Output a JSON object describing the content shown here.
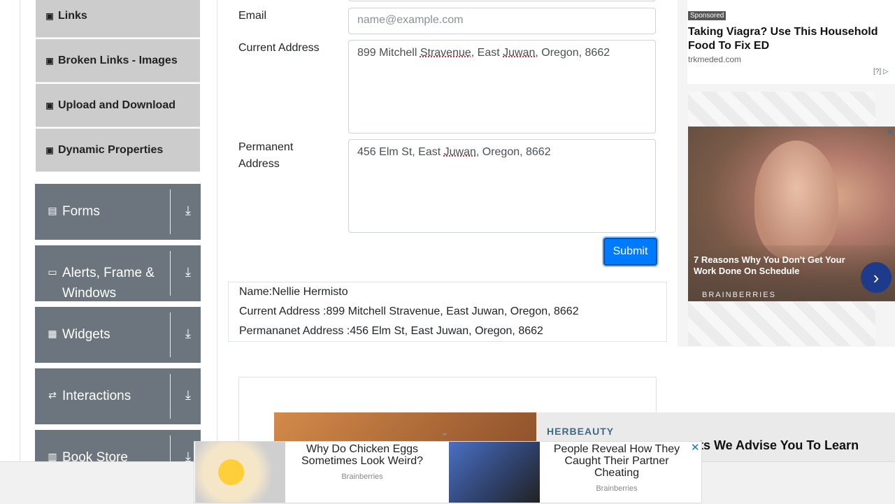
{
  "sidebar": {
    "sub_items": [
      {
        "label": "Links",
        "icon": "html5-icon"
      },
      {
        "label": "Broken Links - Images",
        "icon": "html5-icon"
      },
      {
        "label": "Upload and Download",
        "icon": "html5-icon"
      },
      {
        "label": "Dynamic Properties",
        "icon": "html5-icon"
      }
    ],
    "groups": [
      {
        "label": "Forms",
        "icon": "document-icon"
      },
      {
        "label": "Alerts, Frame & Windows",
        "icon": "window-icon"
      },
      {
        "label": "Widgets",
        "icon": "widgets-icon"
      },
      {
        "label": "Interactions",
        "icon": "arrows-icon"
      },
      {
        "label": "Book Store",
        "icon": "books-icon"
      }
    ]
  },
  "form": {
    "email_label": "Email",
    "email_placeholder": "name@example.com",
    "current_address_label": "Current Address",
    "current_address_parts": [
      "899 Mitchell ",
      "Stravenue",
      ", East ",
      "Juwan",
      ", Oregon, 8662"
    ],
    "permanent_address_label_1": "Permanent",
    "permanent_address_label_2": "Address",
    "permanent_address_parts": [
      "456 Elm St, East ",
      "Juwan",
      ", Oregon, 8662"
    ],
    "submit_label": "Submit"
  },
  "output": {
    "name": "Name:Nellie Hermisto",
    "current_address": "Current Address :899 Mitchell Stravenue, East Juwan, Oregon, 8662",
    "permanent_address": "Permananet Address :456 Elm St, East Juwan, Oregon, 8662"
  },
  "ad_right": {
    "sponsored": "Sponsored",
    "headline": "Taking Viagra? Use This Household Food To Fix ED",
    "source": "trkmeded.com",
    "info": "[?]",
    "image_caption": "7 Reasons Why You Don't Get Your Work Done On Schedule",
    "image_brand": "BRAINBERRIES"
  },
  "bottom_ad": {
    "brand": "HERBEAUTY",
    "title": "ets We Advise You To Learn"
  },
  "native_ads": [
    {
      "title": "Why Do Chicken Eggs Sometimes Look Weird?",
      "source": "Brainberries"
    },
    {
      "title": "People Reveal How They Caught Their Partner Cheating",
      "source": "Brainberries"
    }
  ]
}
